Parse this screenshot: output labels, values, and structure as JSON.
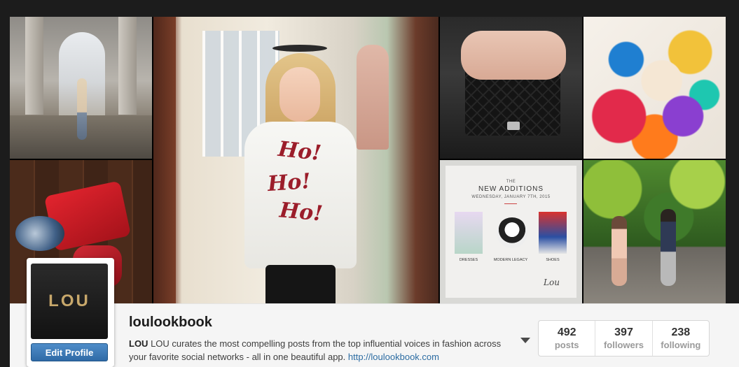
{
  "collage": {
    "big_photo_text": [
      "Ho!",
      "Ho!",
      "Ho!"
    ],
    "card": {
      "the": "THE",
      "headline": "NEW ADDITIONS",
      "date": "WEDNESDAY, JANUARY 7TH, 2015",
      "labels": [
        "DRESSES",
        "MODERN LEGACY",
        "SHOES"
      ],
      "signature": "Lou"
    }
  },
  "profile": {
    "avatar_text": "LOU",
    "edit_button": "Edit Profile",
    "username": "loulookbook",
    "bio_name": "LOU",
    "bio_text": " LOU curates the most compelling posts from the top influential voices in fashion across your favorite social networks - all in one beautiful app. ",
    "bio_link": "http://loulookbook.com"
  },
  "stats": [
    {
      "count": "492",
      "label": "posts"
    },
    {
      "count": "397",
      "label": "followers"
    },
    {
      "count": "238",
      "label": "following"
    }
  ],
  "colors": {
    "background": "#1c1c1c",
    "button_blue": "#3a77b5",
    "link_blue": "#2c6ca2",
    "avatar_gold": "#c8a86b"
  },
  "icons": {
    "dropdown": "caret-down-icon"
  }
}
